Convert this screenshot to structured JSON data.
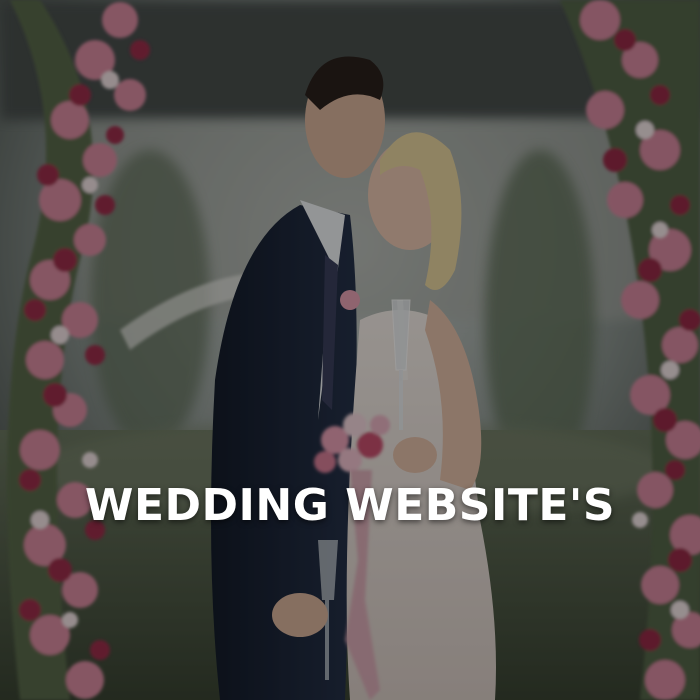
{
  "banner": {
    "title": "WEDDING WEBSITE'S",
    "photo_subject": "bride-and-groom-kissing-photo",
    "overlay_color": "#000000",
    "text_color": "#ffffff"
  }
}
